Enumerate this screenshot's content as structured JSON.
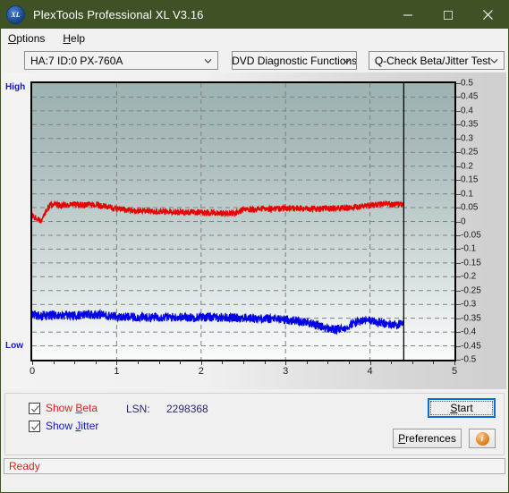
{
  "window": {
    "title": "PlexTools Professional XL V3.16",
    "app_icon": "xl-logo-icon",
    "minimize": "minimize-icon",
    "maximize": "maximize-icon",
    "close": "close-icon"
  },
  "menubar": {
    "items": [
      {
        "label": "Options",
        "accel": "O"
      },
      {
        "label": "Help",
        "accel": "H"
      }
    ]
  },
  "toolbar": {
    "drive_select": "HA:7 ID:0  PX-760A",
    "function_select": "DVD Diagnostic Functions",
    "test_select": "Q-Check Beta/Jitter Test",
    "dropdown_icon": "chevron-down-icon"
  },
  "options": {
    "show_beta_label": "Show Beta",
    "show_beta_checked": true,
    "show_jitter_label": "Show Jitter",
    "show_jitter_checked": true,
    "lsn_label": "LSN:",
    "lsn_value": "2298368",
    "start_label": "Start",
    "preferences_label": "Preferences",
    "info_label": "i",
    "info_icon": "info-circle-icon"
  },
  "statusbar": {
    "text": "Ready"
  },
  "colors": {
    "titlebar": "#3f5226",
    "beta": "#e60000",
    "jitter": "#0000e6",
    "status_text": "#e02020",
    "axis_label": "#1414d0",
    "focus_border": "#0a6ed1"
  },
  "chart_data": {
    "type": "line",
    "title": "Q-Check Beta/Jitter Test",
    "xlabel": "",
    "ylabel": "",
    "xlim": [
      0,
      5
    ],
    "ylim": [
      -0.5,
      0.5
    ],
    "xticks": [
      0,
      1,
      2,
      3,
      4,
      5
    ],
    "yticks": [
      0.5,
      0.45,
      0.4,
      0.35,
      0.3,
      0.25,
      0.2,
      0.15,
      0.1,
      0.05,
      0,
      -0.05,
      -0.1,
      -0.15,
      -0.2,
      -0.25,
      -0.3,
      -0.35,
      -0.4,
      -0.45,
      -0.5
    ],
    "ytick_labels": [
      "0.5",
      "0.45",
      "0.4",
      "0.35",
      "0.3",
      "0.25",
      "0.2",
      "0.15",
      "0.1",
      "0.05",
      "0",
      "-0.05",
      "-0.1",
      "-0.15",
      "-0.2",
      "-0.25",
      "-0.3",
      "-0.35",
      "-0.4",
      "-0.45",
      "-0.5"
    ],
    "xtick_labels": [
      "0",
      "1",
      "2",
      "3",
      "4",
      "5"
    ],
    "left_axis_top_label": "High",
    "left_axis_bottom_label": "Low",
    "grid": true,
    "grid_style": "dashed",
    "legend_position": "external-checkboxes",
    "data_end_x": 4.4,
    "cursor_line_x": 4.4,
    "series": [
      {
        "name": "Show Beta",
        "color": "#e60000",
        "noise": 0.011,
        "x": [
          0.0,
          0.05,
          0.1,
          0.15,
          0.2,
          0.25,
          0.3,
          0.35,
          0.4,
          0.5,
          0.6,
          0.7,
          0.8,
          0.9,
          1.0,
          1.1,
          1.2,
          1.3,
          1.4,
          1.5,
          1.6,
          1.7,
          1.8,
          1.9,
          2.0,
          2.1,
          2.2,
          2.3,
          2.4,
          2.5,
          2.6,
          2.7,
          2.8,
          2.9,
          3.0,
          3.1,
          3.2,
          3.3,
          3.4,
          3.5,
          3.6,
          3.7,
          3.8,
          3.9,
          4.0,
          4.1,
          4.2,
          4.3,
          4.4
        ],
        "y": [
          0.02,
          0.012,
          0.0,
          0.03,
          0.055,
          0.062,
          0.06,
          0.058,
          0.06,
          0.061,
          0.059,
          0.062,
          0.058,
          0.052,
          0.046,
          0.042,
          0.04,
          0.038,
          0.037,
          0.036,
          0.035,
          0.034,
          0.034,
          0.033,
          0.033,
          0.032,
          0.031,
          0.03,
          0.03,
          0.042,
          0.044,
          0.045,
          0.046,
          0.047,
          0.048,
          0.047,
          0.046,
          0.046,
          0.046,
          0.047,
          0.047,
          0.048,
          0.05,
          0.055,
          0.058,
          0.061,
          0.062,
          0.062,
          0.061
        ]
      },
      {
        "name": "Show Jitter",
        "color": "#0000e6",
        "noise": 0.016,
        "x": [
          0.0,
          0.05,
          0.1,
          0.2,
          0.3,
          0.4,
          0.5,
          0.6,
          0.7,
          0.8,
          0.9,
          1.0,
          1.1,
          1.2,
          1.3,
          1.4,
          1.5,
          1.6,
          1.7,
          1.8,
          1.9,
          2.0,
          2.1,
          2.2,
          2.3,
          2.4,
          2.5,
          2.6,
          2.7,
          2.8,
          2.9,
          3.0,
          3.1,
          3.2,
          3.3,
          3.4,
          3.5,
          3.6,
          3.7,
          3.8,
          3.9,
          4.0,
          4.1,
          4.2,
          4.3,
          4.4
        ],
        "y": [
          -0.338,
          -0.34,
          -0.342,
          -0.34,
          -0.339,
          -0.34,
          -0.341,
          -0.338,
          -0.337,
          -0.336,
          -0.34,
          -0.345,
          -0.346,
          -0.346,
          -0.347,
          -0.347,
          -0.346,
          -0.346,
          -0.346,
          -0.347,
          -0.347,
          -0.346,
          -0.346,
          -0.347,
          -0.348,
          -0.348,
          -0.349,
          -0.35,
          -0.351,
          -0.352,
          -0.353,
          -0.355,
          -0.358,
          -0.362,
          -0.368,
          -0.378,
          -0.388,
          -0.392,
          -0.385,
          -0.368,
          -0.36,
          -0.358,
          -0.366,
          -0.372,
          -0.374,
          -0.372
        ]
      }
    ]
  }
}
